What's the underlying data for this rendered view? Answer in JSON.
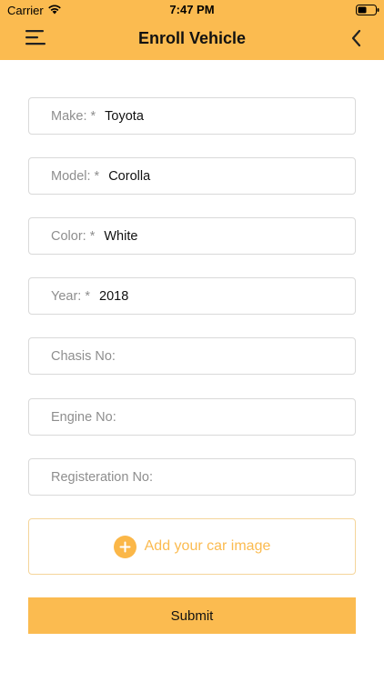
{
  "status_bar": {
    "carrier": "Carrier",
    "time": "7:47 PM"
  },
  "navbar": {
    "title": "Enroll Vehicle",
    "menu_icon": "menu-icon",
    "back_icon": "chevron-left-icon"
  },
  "form": {
    "make": {
      "label": "Make: *",
      "value": "Toyota"
    },
    "model": {
      "label": "Model: *",
      "value": "Corolla"
    },
    "color": {
      "label": "Color: *",
      "value": "White"
    },
    "year": {
      "label": "Year: *",
      "value": "2018"
    },
    "chasis": {
      "label": "Chasis No:",
      "value": ""
    },
    "engine": {
      "label": "Engine No:",
      "value": ""
    },
    "registration": {
      "label": "Registeration No:",
      "value": ""
    }
  },
  "add_image": {
    "label": "Add your car image",
    "icon": "plus-circle-icon"
  },
  "submit_label": "Submit",
  "colors": {
    "accent": "#FBBB50",
    "text": "#111111",
    "label": "#8E8E8E",
    "border": "#D9D9D9"
  }
}
